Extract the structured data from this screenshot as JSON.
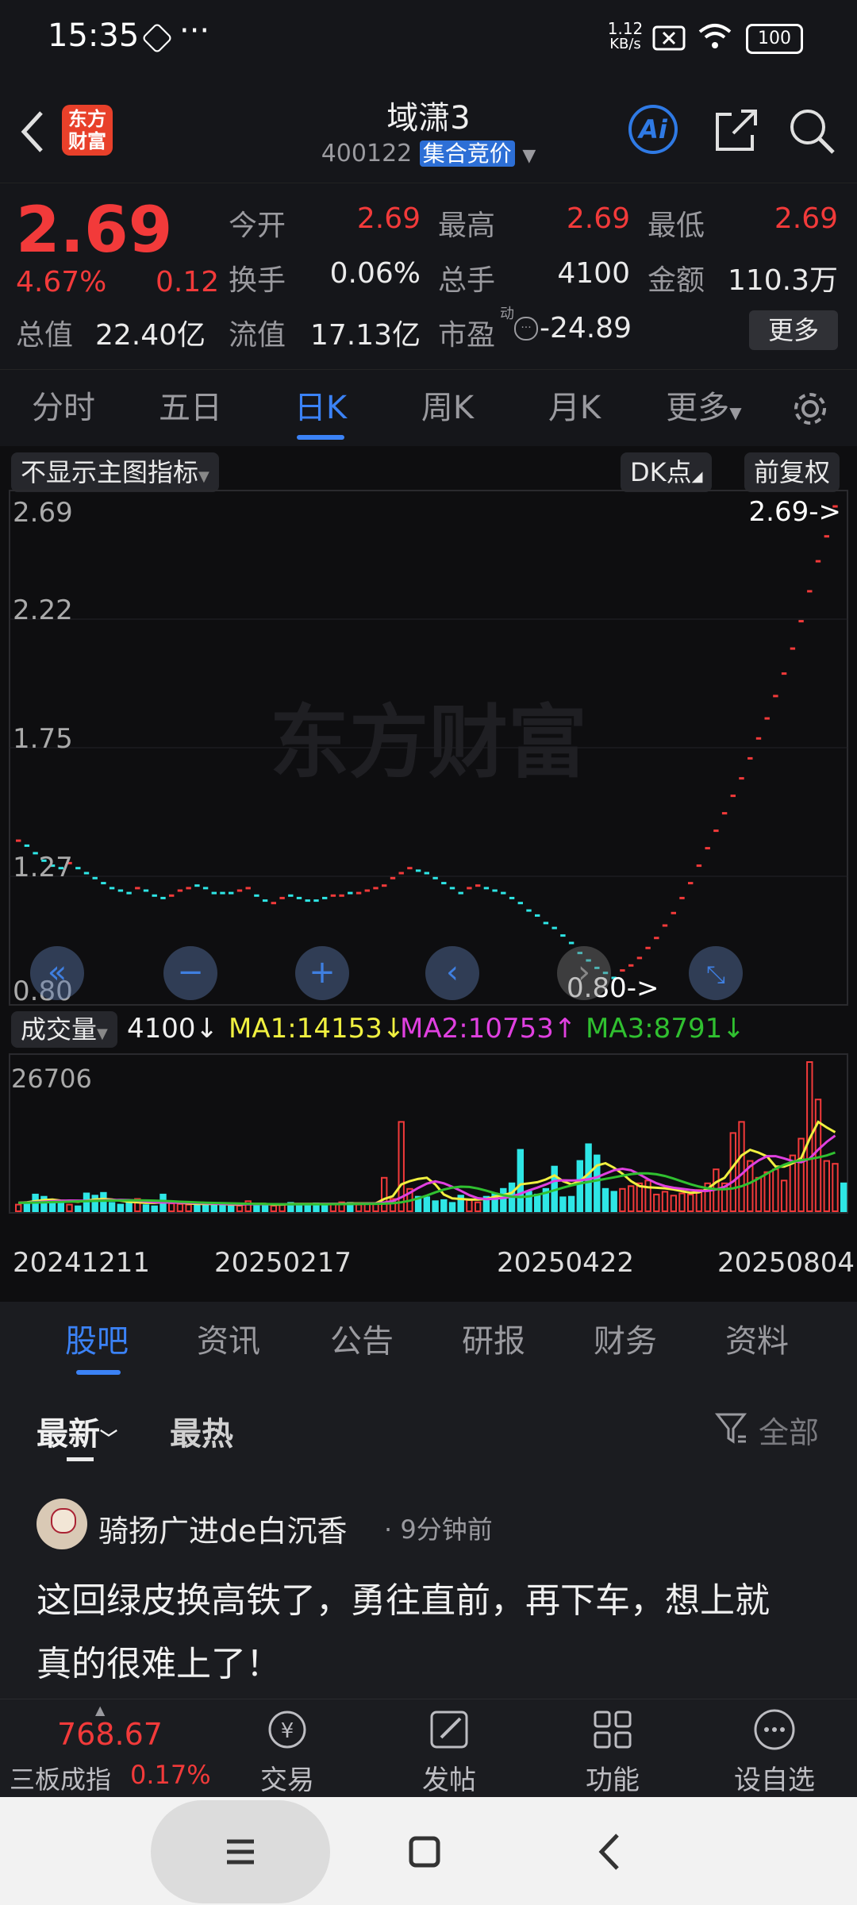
{
  "status": {
    "time": "15:35",
    "net_speed_top": "1.12",
    "net_speed_unit": "KB/s",
    "battery": "100"
  },
  "header": {
    "logo_top": "东方",
    "logo_bottom": "财富",
    "stock_name": "域潇3",
    "stock_code": "400122",
    "session_badge": "集合竞价",
    "ai_label": "Ai"
  },
  "quote": {
    "price": "2.69",
    "change_pct": "4.67%",
    "change": "0.12",
    "open_label": "今开",
    "open": "2.69",
    "high_label": "最高",
    "high": "2.69",
    "low_label": "最低",
    "low": "2.69",
    "turnover_label": "换手",
    "turnover": "0.06%",
    "volume_label": "总手",
    "volume": "4100",
    "amount_label": "金额",
    "amount": "110.3万",
    "mktcap_label": "总值",
    "mktcap": "22.40亿",
    "float_label": "流值",
    "float": "17.13亿",
    "pe_label": "市盈",
    "pe_sup": "动",
    "pe": "-24.89",
    "more_button": "更多"
  },
  "tabs": [
    "分时",
    "五日",
    "日K",
    "周K",
    "月K",
    "更多"
  ],
  "chart_bar": {
    "indicator": "不显示主图指标",
    "dk": "DK点",
    "adjust": "前复权"
  },
  "price_chart": {
    "y_ticks": [
      "2.69",
      "2.22",
      "1.75",
      "1.27",
      "0.80"
    ],
    "high_marker": "2.69->",
    "low_marker": "0.80->",
    "watermark": "东方财富"
  },
  "volume_bar": {
    "label": "成交量",
    "vol": "4100↓",
    "ma1": "MA1:14153↓",
    "ma2": "MA2:10753↑",
    "ma3": "MA3:8791↓"
  },
  "volume_chart": {
    "max_label": "26706",
    "x_dates": [
      "20241211",
      "20250217",
      "20250422",
      "20250804"
    ]
  },
  "news_tabs": [
    "股吧",
    "资讯",
    "公告",
    "研报",
    "财务",
    "资料"
  ],
  "feed": {
    "sort_latest": "最新",
    "sort_hot": "最热",
    "filter": "全部"
  },
  "post": {
    "author": "骑扬广进de白沉香",
    "time": "· 9分钟前",
    "text_line1": "这回绿皮换高铁了，勇往直前，再下车，想上就",
    "text_line2": "真的很难上了！"
  },
  "bottom": {
    "index_value": "768.67",
    "index_name": "三板成指",
    "index_change": "0.17%",
    "nav": [
      "交易",
      "发帖",
      "功能",
      "设自选"
    ]
  },
  "colors": {
    "up": "#f23a3a",
    "down": "#2ee6e6",
    "accent": "#3b82f6",
    "ma1": "#f0f040",
    "ma2": "#e040e0",
    "ma3": "#30c030"
  },
  "chart_data": {
    "type": "candlestick+volume",
    "price_ylim": [
      0.8,
      2.69
    ],
    "closes": [
      1.35,
      1.33,
      1.3,
      1.27,
      1.25,
      1.24,
      1.26,
      1.24,
      1.22,
      1.2,
      1.18,
      1.16,
      1.15,
      1.14,
      1.16,
      1.15,
      1.13,
      1.12,
      1.13,
      1.15,
      1.16,
      1.17,
      1.16,
      1.14,
      1.14,
      1.14,
      1.15,
      1.16,
      1.13,
      1.11,
      1.1,
      1.12,
      1.13,
      1.12,
      1.11,
      1.11,
      1.12,
      1.13,
      1.13,
      1.14,
      1.14,
      1.15,
      1.16,
      1.17,
      1.2,
      1.22,
      1.24,
      1.23,
      1.22,
      1.2,
      1.18,
      1.16,
      1.14,
      1.16,
      1.17,
      1.16,
      1.15,
      1.14,
      1.12,
      1.1,
      1.07,
      1.05,
      1.02,
      1.0,
      0.97,
      0.94,
      0.9,
      0.87,
      0.84,
      0.82,
      0.8,
      0.83,
      0.85,
      0.88,
      0.92,
      0.96,
      1.01,
      1.06,
      1.12,
      1.18,
      1.25,
      1.32,
      1.39,
      1.46,
      1.53,
      1.6,
      1.68,
      1.76,
      1.84,
      1.93,
      2.02,
      2.12,
      2.23,
      2.35,
      2.47,
      2.57,
      2.69
    ],
    "up_days": [
      0,
      6,
      14,
      18,
      19,
      20,
      26,
      27,
      30,
      31,
      37,
      38,
      40,
      41,
      42,
      43,
      44,
      45,
      46,
      53,
      54,
      71,
      72,
      73,
      74,
      75,
      76,
      77,
      78,
      79,
      80,
      81,
      82,
      83,
      84,
      85,
      86,
      87,
      88,
      89,
      90,
      91,
      92,
      93,
      94,
      95,
      96
    ],
    "volume_max": 26706,
    "volumes": [
      1200,
      1500,
      3000,
      2600,
      1400,
      1800,
      1200,
      900,
      3200,
      2800,
      3300,
      1500,
      1200,
      1600,
      2200,
      1100,
      900,
      3000,
      1400,
      1300,
      1200,
      1000,
      1500,
      1400,
      1300,
      900,
      1000,
      1800,
      1100,
      1300,
      1000,
      1200,
      1500,
      1300,
      1100,
      1400,
      1000,
      1300,
      1600,
      1500,
      1200,
      1300,
      1400,
      6000,
      2200,
      16000,
      4000,
      2600,
      2500,
      1800,
      2000,
      1500,
      2800,
      2000,
      1600,
      2600,
      3200,
      4000,
      5000,
      11000,
      3500,
      3000,
      4000,
      8000,
      2500,
      2600,
      9000,
      12000,
      10000,
      4000,
      3500,
      4000,
      4500,
      5000,
      5500,
      3000,
      3500,
      2800,
      3200,
      3000,
      3800,
      5000,
      7500,
      5000,
      14000,
      16000,
      9000,
      6000,
      7000,
      7500,
      5500,
      10000,
      13000,
      26706,
      20000,
      9000,
      8500,
      5000
    ],
    "ma1": [
      1500,
      1600,
      1800,
      2000,
      2100,
      1900,
      1800,
      1700,
      1900,
      2100,
      2200,
      2100,
      1900,
      1700,
      1600,
      1500,
      1500,
      1600,
      1600,
      1500,
      1400,
      1300,
      1300,
      1300,
      1300,
      1200,
      1200,
      1300,
      1300,
      1300,
      1200,
      1200,
      1300,
      1300,
      1300,
      1300,
      1300,
      1300,
      1300,
      1400,
      1400,
      1400,
      1400,
      2200,
      2700,
      4800,
      5400,
      5800,
      6000,
      4800,
      3000,
      2300,
      2200,
      2100,
      2100,
      2200,
      2600,
      2900,
      3300,
      4800,
      5000,
      5200,
      5700,
      6400,
      5400,
      4800,
      5400,
      6700,
      8200,
      8600,
      7800,
      6700,
      5400,
      4500,
      4300,
      4200,
      4100,
      3900,
      3600,
      3300,
      3400,
      4000,
      5200,
      6000,
      8000,
      10000,
      11000,
      10500,
      9800,
      8000,
      8000,
      8600,
      9500,
      13000,
      16000,
      15000,
      14153
    ]
  }
}
